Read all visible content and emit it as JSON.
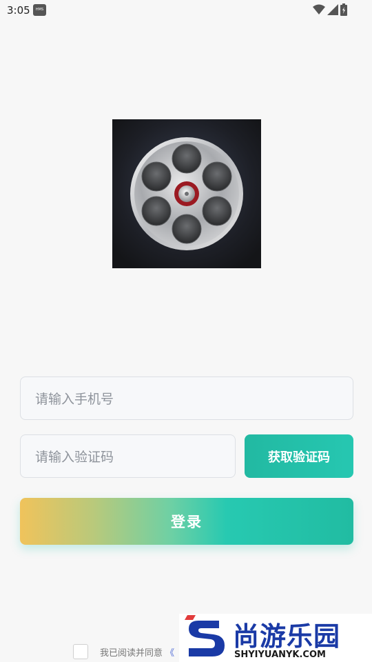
{
  "status_bar": {
    "time": "3:05",
    "notification_icon": "hms-icon",
    "icons": [
      "wifi-icon",
      "signal-icon",
      "battery-icon"
    ]
  },
  "logo": {
    "icon": "film-reel-icon"
  },
  "form": {
    "phone_placeholder": "请输入手机号",
    "code_placeholder": "请输入验证码",
    "get_code_label": "获取验证码",
    "login_label": "登录"
  },
  "agreement": {
    "text": "我已阅读并同意",
    "link": "《",
    "checked": false
  },
  "watermark": {
    "title": "尚游乐园",
    "url": "SHYIYUANYK.COM"
  },
  "colors": {
    "accent": "#22b9a2",
    "gradient_start": "#f0c35b",
    "background": "#f7f7f7",
    "watermark_blue": "#1a3aa6",
    "watermark_red": "#e23b3b"
  }
}
